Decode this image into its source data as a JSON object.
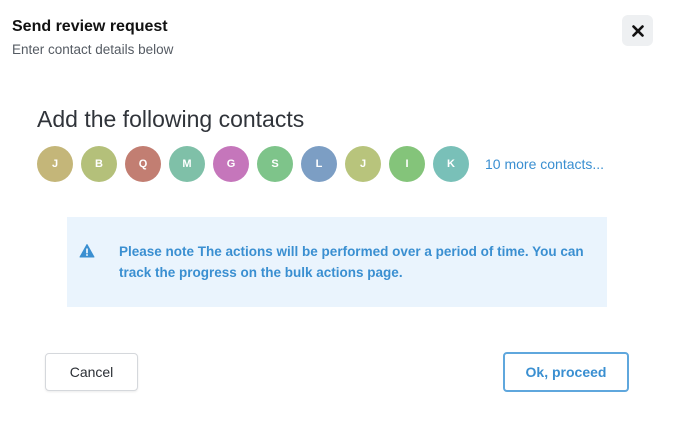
{
  "header": {
    "title": "Send review request",
    "subtitle": "Enter contact details below",
    "close_icon": "close-icon"
  },
  "contacts": {
    "heading": "Add the following contacts",
    "avatars": [
      {
        "initial": "J",
        "color": "#c4b679"
      },
      {
        "initial": "B",
        "color": "#b4c07a"
      },
      {
        "initial": "Q",
        "color": "#c27e72"
      },
      {
        "initial": "M",
        "color": "#7fc0a8"
      },
      {
        "initial": "G",
        "color": "#c576bb"
      },
      {
        "initial": "S",
        "color": "#7ec48a"
      },
      {
        "initial": "L",
        "color": "#7c9ec4"
      },
      {
        "initial": "J",
        "color": "#b8c47c"
      },
      {
        "initial": "I",
        "color": "#84c47a"
      },
      {
        "initial": "K",
        "color": "#79c0b8"
      }
    ],
    "more_link": "10 more contacts..."
  },
  "notice": {
    "icon": "warning-icon",
    "text": "Please note The actions will be performed over a period of time. You can track the progress on the bulk actions page."
  },
  "actions": {
    "cancel_label": "Cancel",
    "proceed_label": "Ok, proceed"
  },
  "colors": {
    "accent": "#3a8fd1",
    "notice_background": "#eaf4fd"
  }
}
